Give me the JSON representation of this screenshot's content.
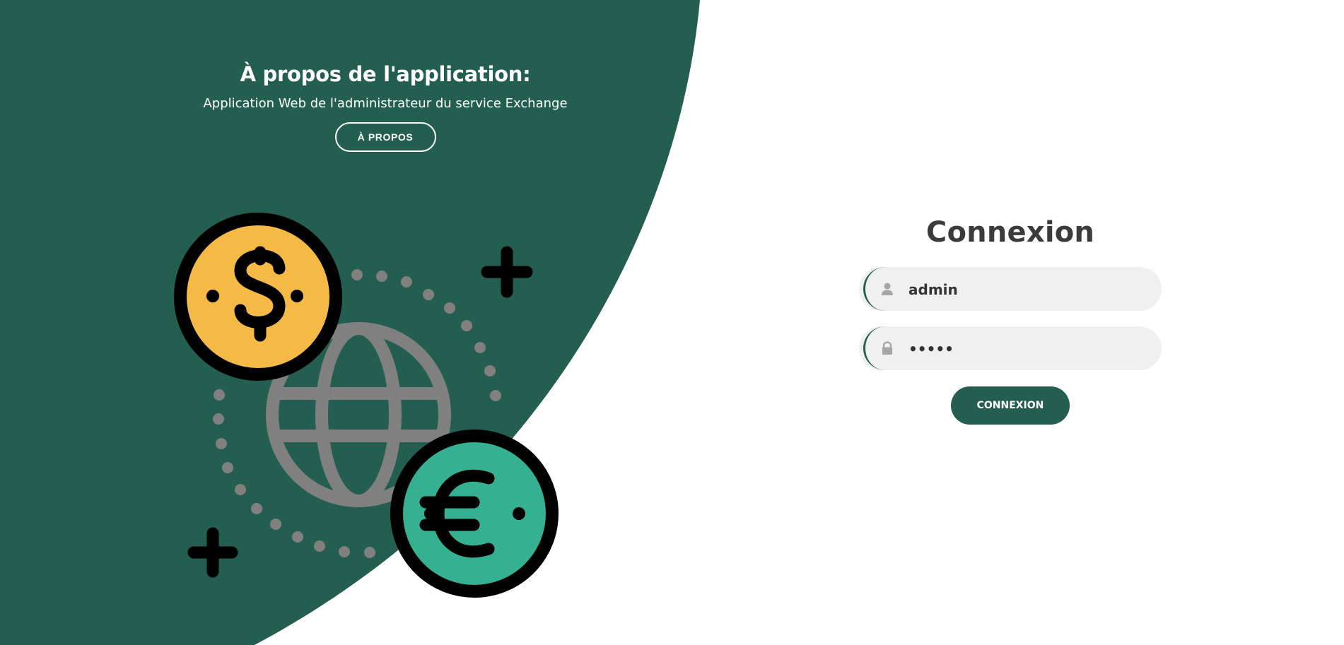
{
  "colors": {
    "brand_green": "#235e50",
    "coin_dollar": "#f5b946",
    "coin_euro": "#35b092",
    "globe_grey": "#808080",
    "field_bg": "#f0f0f0"
  },
  "about": {
    "title": "À propos de l'application:",
    "description": "Application Web de l'administrateur du service Exchange",
    "button_label": "À PROPOS"
  },
  "illustration": {
    "icons": [
      "dollar-coin-icon",
      "euro-coin-icon",
      "globe-icon",
      "plus-icon",
      "dotted-orbit"
    ]
  },
  "login": {
    "title": "Connexion",
    "username": {
      "icon": "user-icon",
      "value": "admin"
    },
    "password": {
      "icon": "lock-icon",
      "value": "•••••"
    },
    "submit_label": "CONNEXION"
  }
}
